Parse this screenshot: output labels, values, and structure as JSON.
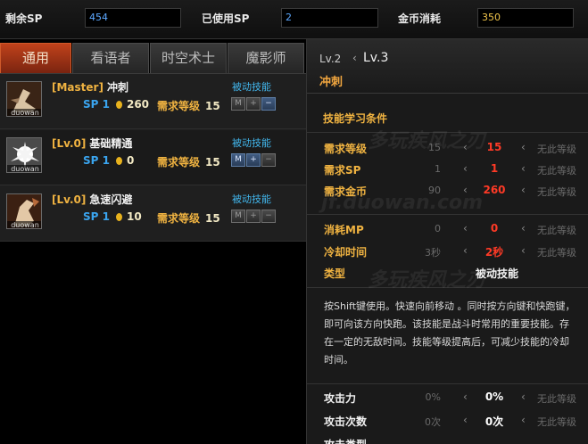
{
  "top": {
    "remaining_sp_label": "剩余SP",
    "remaining_sp_value": "454",
    "used_sp_label": "已使用SP",
    "used_sp_value": "2",
    "gold_label": "金币消耗",
    "gold_value": "350"
  },
  "tabs": [
    "通用",
    "看语者",
    "时空术士",
    "魔影师"
  ],
  "skills": [
    {
      "level": "[Master]",
      "name": "冲刺",
      "type": "被动技能",
      "sp_label": "SP",
      "sp": "1",
      "gold": "260",
      "req_label": "需求等级",
      "req": "15",
      "icon_caption": "duowan"
    },
    {
      "level": "[Lv.0]",
      "name": "基础精通",
      "type": "被动技能",
      "sp_label": "SP",
      "sp": "1",
      "gold": "0",
      "req_label": "需求等级",
      "req": "15",
      "icon_caption": "duowan"
    },
    {
      "level": "[Lv.0]",
      "name": "急速闪避",
      "type": "被动技能",
      "sp_label": "SP",
      "sp": "1",
      "gold": "10",
      "req_label": "需求等级",
      "req": "15",
      "icon_caption": "duowan"
    }
  ],
  "buttons": {
    "m": "M",
    "plus": "+",
    "minus": "−"
  },
  "detail": {
    "from_level": "Lv.2",
    "arrow": "‹",
    "to_level": "Lv.3",
    "title": "冲刺",
    "cond_title": "技能学习条件",
    "lt": "‹",
    "rows": [
      {
        "label": "需求等级",
        "cur": "15",
        "next": "15",
        "max": "无此等级"
      },
      {
        "label": "需求SP",
        "cur": "1",
        "next": "1",
        "max": "无此等级"
      },
      {
        "label": "需求金币",
        "cur": "90",
        "next": "260",
        "max": "无此等级"
      },
      {
        "label": "消耗MP",
        "cur": "0",
        "next": "0",
        "max": "无此等级"
      },
      {
        "label": "冷却时间",
        "cur": "3秒",
        "next": "2秒",
        "max": "无此等级"
      }
    ],
    "type_label": "类型",
    "type_value": "被动技能",
    "description": "按Shift键使用。快速向前移动 。同时按方向键和快跑键，即可向该方向快跑。该技能是战斗时常用的重要技能。存在一定的无敌时间。技能等级提高后，可减少技能的冷却时间。",
    "attack_rows": [
      {
        "label": "攻击力",
        "cur": "0%",
        "next": "0%",
        "max": "无此等级"
      },
      {
        "label": "攻击次数",
        "cur": "0次",
        "next": "0次",
        "max": "无此等级"
      }
    ],
    "attack_type_label": "攻击类型"
  },
  "watermarks": [
    "多玩疾风之刃",
    "jf.duowan.com",
    "多玩疾风之刃"
  ],
  "colors": {
    "accent_orange": "#f0b341",
    "red": "#ff3a26",
    "blue": "#42b6ec",
    "tab_active": "#c0421b"
  }
}
